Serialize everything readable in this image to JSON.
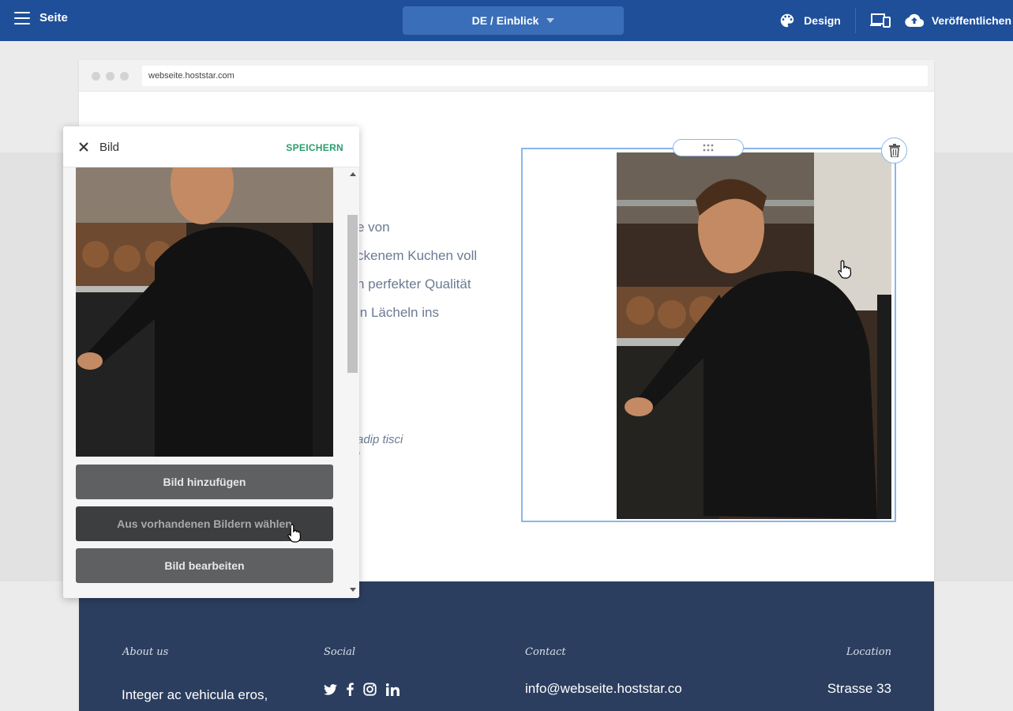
{
  "topbar": {
    "menu_label": "Seite",
    "page_selector": "DE / Einblick",
    "design_label": "Design",
    "publish_label": "Veröffentlichen"
  },
  "browser": {
    "url": "webseite.hoststar.com"
  },
  "content": {
    "lines": [
      "e von",
      "ckenem Kuchen voll",
      "n perfekter Qualität",
      "in Lächeln ins"
    ],
    "quote": "adip tisci",
    "quote_mark": "\""
  },
  "panel": {
    "title": "Bild",
    "save_label": "SPEICHERN",
    "buttons": {
      "add": "Bild hinzufügen",
      "choose": "Aus vorhandenen Bildern wählen",
      "edit": "Bild bearbeiten"
    }
  },
  "footer": {
    "about_heading": "About us",
    "about_text": "Integer ac vehicula eros,",
    "social_heading": "Social",
    "social_icons": [
      "twitter-icon",
      "facebook-icon",
      "instagram-icon",
      "linkedin-icon"
    ],
    "contact_heading": "Contact",
    "contact_email": "info@webseite.hoststar.co",
    "location_heading": "Location",
    "location_text": "Strasse 33"
  },
  "colors": {
    "topbar": "#1f4f99",
    "page_selector": "#3a6eb8",
    "footer": "#2c3e5f",
    "save_accent": "#2a9d6f",
    "selection": "#8ab6ec"
  }
}
